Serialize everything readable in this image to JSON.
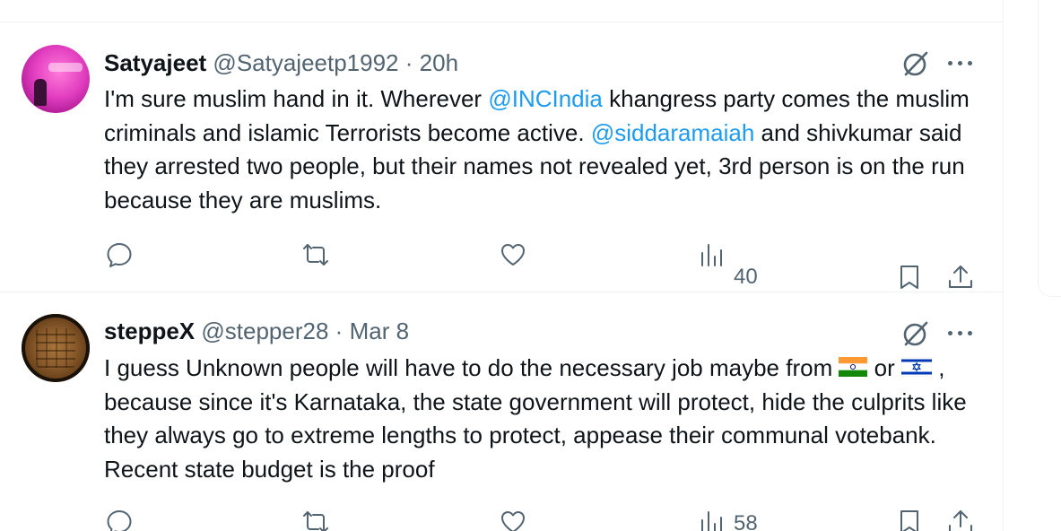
{
  "tweets": [
    {
      "name": "Satyajeet",
      "handle": "@Satyajeetp1992",
      "separator": "·",
      "time": "20h",
      "text": [
        {
          "t": "I'm sure muslim hand in it. Wherever ",
          "mention": false
        },
        {
          "t": "@INCIndia",
          "mention": true
        },
        {
          "t": " khangress party comes the muslim criminals and islamic Terrorists become active. ",
          "mention": false
        },
        {
          "t": "@siddaramaiah",
          "mention": true
        },
        {
          "t": " and shivkumar said they arrested two people, but their names not revealed yet, 3rd person is on the run because they are muslims.",
          "mention": false
        }
      ],
      "views": "40"
    },
    {
      "name": "steppeX",
      "handle": "@stepper28",
      "separator": "·",
      "time": "Mar 8",
      "text_a": "I guess Unknown people will have to do the necessary job maybe from ",
      "text_b": " or ",
      "text_c": " , because since it's Karnataka, the state government will protect, hide the culprits like they always go to extreme lengths to protect, appease their communal votebank. Recent state budget is the proof",
      "flags": [
        "india-flag-emoji",
        "israel-flag-emoji"
      ],
      "views": "58"
    }
  ],
  "colors": {
    "text": "#0f1419",
    "secondary": "#536471",
    "mention": "#1d9bf0",
    "divider": "#eff3f4"
  },
  "icons": [
    "reply-icon",
    "retweet-icon",
    "like-icon",
    "views-icon",
    "bookmark-icon",
    "share-icon",
    "grok-icon",
    "more-icon"
  ]
}
